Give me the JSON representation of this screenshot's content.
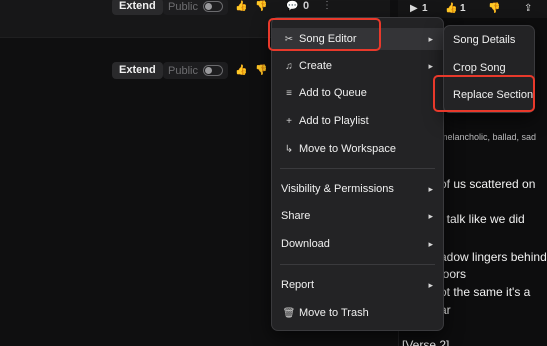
{
  "rows": [
    {
      "extend_label": "Extend",
      "public_label": "Public",
      "like_icon": "thumbs-up-icon",
      "dislike_icon": "thumbs-down-icon",
      "comment_icon": "comment-icon",
      "comment_count": "0",
      "more_icon": "more-vertical-icon"
    },
    {
      "extend_label": "Extend",
      "public_label": "Public",
      "like_icon": "thumbs-up-icon",
      "dislike_icon": "thumbs-down-icon",
      "more_icon": "more-vertical-icon"
    }
  ],
  "right_panel": {
    "play_count": "1",
    "like_count": "1",
    "tags": "melancholic, ballad, sad",
    "lyrics": [
      "of us scattered on",
      "t talk like we did",
      "adow lingers behind",
      "loors",
      "ot the same it's a",
      "ar",
      "[Verse 2]"
    ]
  },
  "main_menu": {
    "items": [
      {
        "label": "Song Editor",
        "icon": "scissors-icon",
        "has_submenu": true,
        "active": true
      },
      {
        "label": "Create",
        "icon": "music-note-icon",
        "has_submenu": true
      },
      {
        "label": "Add to Queue",
        "icon": "queue-icon",
        "has_submenu": false
      },
      {
        "label": "Add to Playlist",
        "icon": "plus-icon",
        "has_submenu": false
      },
      {
        "label": "Move to Workspace",
        "icon": "move-arrow-icon",
        "has_submenu": false
      },
      {
        "label": "Visibility & Permissions",
        "has_submenu": true
      },
      {
        "label": "Share",
        "has_submenu": true
      },
      {
        "label": "Download",
        "has_submenu": true
      },
      {
        "label": "Report",
        "has_submenu": true
      },
      {
        "label": "Move to Trash",
        "icon": "trash-icon",
        "has_submenu": false
      }
    ]
  },
  "sub_menu": {
    "items": [
      {
        "label": "Song Details"
      },
      {
        "label": "Crop Song"
      },
      {
        "label": "Replace Section"
      }
    ]
  },
  "colors": {
    "highlight": "#e8392b",
    "menu_bg": "#232325",
    "page_bg": "#0f0f10"
  }
}
